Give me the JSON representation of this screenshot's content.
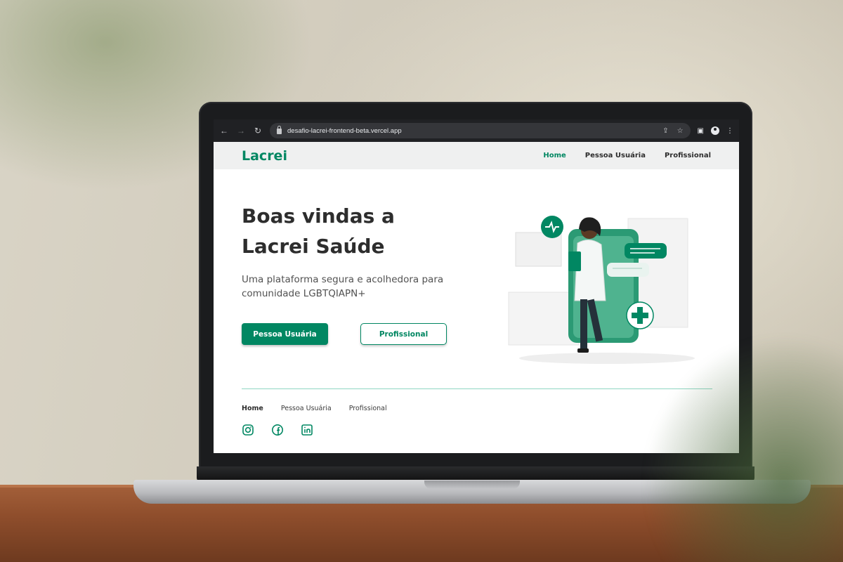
{
  "browser": {
    "url": "desafio-lacrei-frontend-beta.vercel.app",
    "back_icon": "←",
    "forward_icon": "→",
    "reload_icon": "↻",
    "share_icon": "⇪",
    "star_icon": "☆",
    "sidepanel_icon": "▣",
    "menu_icon": "⋮"
  },
  "header": {
    "logo": "Lacrei",
    "nav": [
      "Home",
      "Pessoa Usuária",
      "Profissional"
    ],
    "active": "Home"
  },
  "hero": {
    "title": "Boas vindas a Lacrei Saúde",
    "subtitle": "Uma plataforma segura e acolhedora para comunidade LGBTQIAPN+",
    "primary_button": "Pessoa Usuária",
    "secondary_button": "Profissional"
  },
  "footer": {
    "nav": [
      "Home",
      "Pessoa Usuária",
      "Profissional"
    ],
    "social": [
      "instagram-icon",
      "facebook-icon",
      "linkedin-icon"
    ]
  },
  "colors": {
    "brand": "#018762",
    "header_bg": "#eff0f0",
    "text": "#2d2d2d"
  }
}
